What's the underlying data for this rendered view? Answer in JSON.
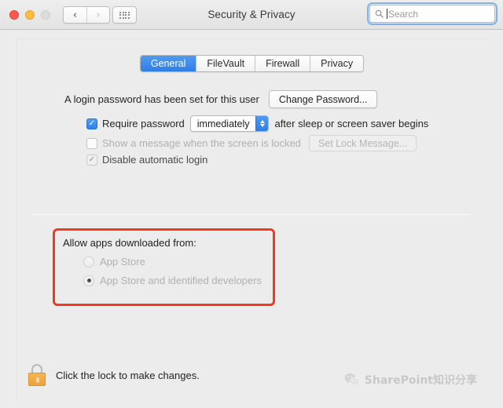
{
  "window": {
    "title": "Security & Privacy",
    "traffic_lights": [
      {
        "name": "close",
        "color": "#f9574f",
        "enabled": true
      },
      {
        "name": "minimize",
        "color": "#fcbc40",
        "enabled": true
      },
      {
        "name": "zoom",
        "color": "#dcdcdc",
        "enabled": false
      }
    ],
    "nav": {
      "back_icon": "chevron-left-icon",
      "back_glyph": "‹",
      "back_enabled": true,
      "forward_icon": "chevron-right-icon",
      "forward_glyph": "›",
      "forward_enabled": false,
      "show_all_icon": "grid-icon"
    },
    "search": {
      "placeholder": "Search",
      "value": "",
      "icon": "search-icon",
      "focused": true
    }
  },
  "tabs": [
    {
      "label": "General",
      "active": true
    },
    {
      "label": "FileVault",
      "active": false
    },
    {
      "label": "Firewall",
      "active": false
    },
    {
      "label": "Privacy",
      "active": false
    }
  ],
  "login": {
    "status_text": "A login password has been set for this user",
    "change_password_button": "Change Password...",
    "require_password": {
      "checked": true,
      "enabled": true,
      "label": "Require password",
      "delay_value": "immediately",
      "trailing_label": "after sleep or screen saver begins"
    },
    "show_message": {
      "checked": false,
      "enabled": false,
      "label": "Show a message when the screen is locked",
      "button_label": "Set Lock Message..."
    },
    "disable_auto_login": {
      "checked": true,
      "enabled": false,
      "label": "Disable automatic login"
    }
  },
  "gatekeeper": {
    "title": "Allow apps downloaded from:",
    "enabled": false,
    "options": [
      {
        "label": "App Store",
        "selected": false
      },
      {
        "label": "App Store and identified developers",
        "selected": true
      }
    ],
    "annotation": {
      "shape": "rectangle",
      "color": "#ef3b24"
    }
  },
  "footer": {
    "lock_icon": "lock-closed-icon",
    "lock_state": "locked",
    "text": "Click the lock to make changes."
  },
  "watermark": {
    "icon": "wechat-icon",
    "text": "SharePoint知识分享"
  }
}
